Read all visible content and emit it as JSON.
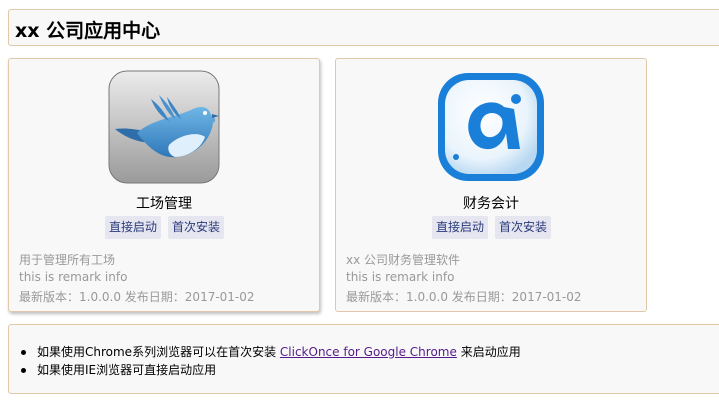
{
  "header": {
    "title": "xx 公司应用中心"
  },
  "apps": [
    {
      "icon": "twitter-bird-icon",
      "name": "工场管理",
      "launch_label": "直接启动",
      "install_label": "首次安装",
      "description": "用于管理所有工场",
      "remark": "this is remark info",
      "version_info": "最新版本：1.0.0.0 发布日期：2017-01-02"
    },
    {
      "icon": "finance-a-icon",
      "name": "财务会计",
      "launch_label": "直接启动",
      "install_label": "首次安装",
      "description": "xx 公司财务管理软件",
      "remark": "this is remark info",
      "version_info": "最新版本：1.0.0.0 发布日期：2017-01-02"
    }
  ],
  "notes": {
    "line1_prefix": "如果使用Chrome系列浏览器可以在首次安装",
    "line1_link": "ClickOnce for Google Chrome",
    "line1_suffix": "来启动应用",
    "line2": "如果使用IE浏览器可直接启动应用"
  },
  "colors": {
    "panel_bg": "#f8f8f8",
    "panel_border": "#e0c8a8",
    "button_bg": "#e6e6f0",
    "link": "#551a8b"
  }
}
